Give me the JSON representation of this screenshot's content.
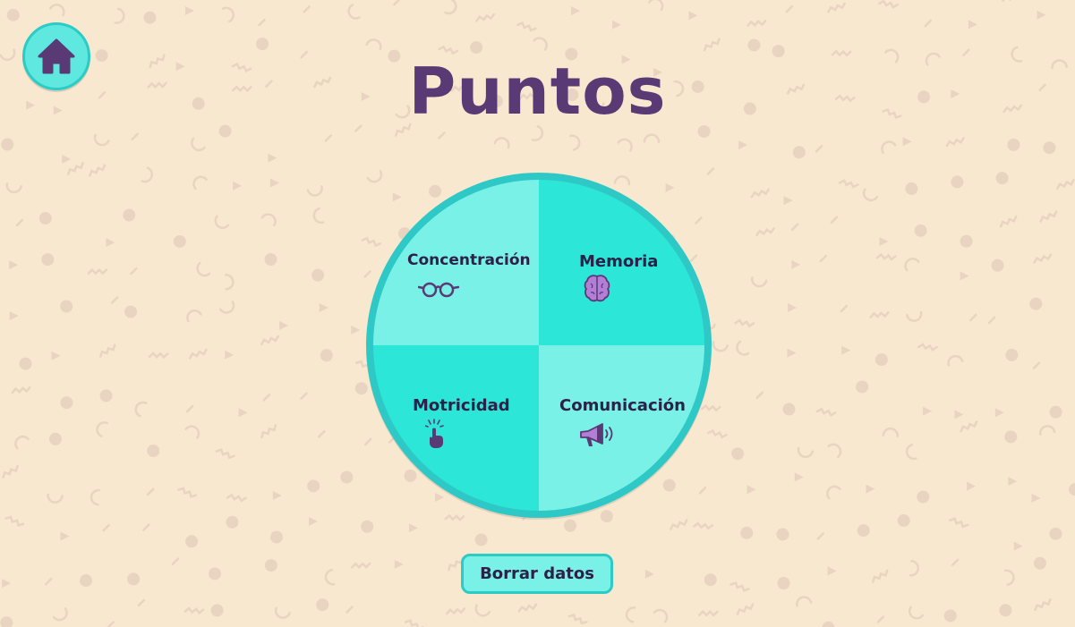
{
  "title": "Puntos",
  "colors": {
    "background": "#f8e8cf",
    "title": "#5a3a75",
    "accent": "#2ce6d8",
    "accent_light": "#7af1e7",
    "accent_border": "#2bcbc6",
    "icon": "#5a3a75"
  },
  "home_button": {
    "icon": "home-icon"
  },
  "categories": [
    {
      "label": "Concentración",
      "icon": "glasses-icon"
    },
    {
      "label": "Memoria",
      "icon": "brain-icon"
    },
    {
      "label": "Motricidad",
      "icon": "tap-finger-icon"
    },
    {
      "label": "Comunicación",
      "icon": "megaphone-icon"
    }
  ],
  "clear_button": {
    "label": "Borrar datos"
  }
}
